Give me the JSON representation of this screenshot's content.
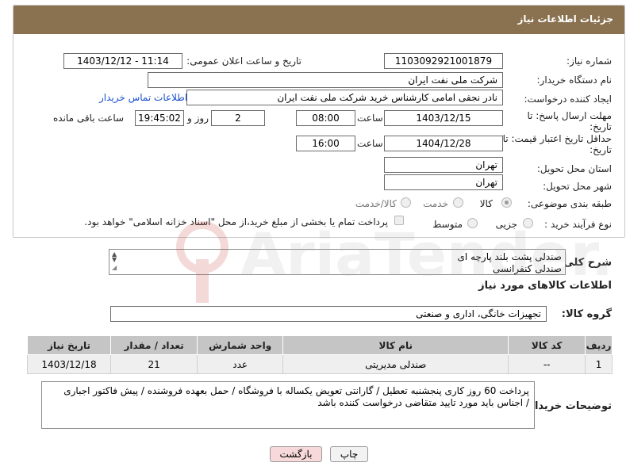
{
  "panel": {
    "title": "جزئیات اطلاعات نیاز"
  },
  "fields": {
    "need_number_label": "شماره نیاز:",
    "need_number": "1103092921001879",
    "announce_label": "تاریخ و ساعت اعلان عمومی:",
    "announce_value": "1403/12/12 - 11:14",
    "buyer_org_label": "نام دستگاه خریدار:",
    "buyer_org": "شرکت ملی نفت ایران",
    "creator_label": "ایجاد کننده درخواست:",
    "creator": "نادر نجفی امامی کارشناس خرید شرکت ملی نفت ایران",
    "contact_link": "اطلاعات تماس خریدار",
    "deadline_label": "مهلت ارسال پاسخ: تا",
    "deadline_label2": "تاریخ:",
    "deadline_date": "1403/12/15",
    "time_label": "ساعت",
    "deadline_time": "08:00",
    "days_value": "2",
    "days_label": "روز و",
    "remaining_time": "19:45:02",
    "remaining_label": "ساعت باقی مانده",
    "validity_label": "حداقل تاریخ اعتبار قیمت: تا",
    "validity_label2": "تاریخ:",
    "validity_date": "1404/12/28",
    "validity_time": "16:00",
    "province_label": "استان محل تحویل:",
    "province": "تهران",
    "city_label": "شهر محل تحویل:",
    "city": "تهران",
    "category_label": "طبقه بندی موضوعی:",
    "category_options": [
      "کالا",
      "خدمت",
      "کالا/خدمت"
    ],
    "process_label": "نوع فرآیند خرید :",
    "process_options": [
      "جزیی",
      "متوسط"
    ],
    "payment_note": "پرداخت تمام یا بخشی از مبلغ خرید،از محل \"اسناد خزانه اسلامی\" خواهد بود."
  },
  "description": {
    "label": "شرح کلی نیاز:",
    "lines": [
      "صندلی پشت بلند پارچه ای",
      "صندلی کنفرانسی"
    ]
  },
  "goods": {
    "section_title": "اطلاعات کالاهای مورد نیاز",
    "group_label": "گروه کالا:",
    "group_value": "تجهیزات خانگی، اداری و صنعتی"
  },
  "table": {
    "headers": [
      "ردیف",
      "کد کالا",
      "نام کالا",
      "واحد شمارش",
      "تعداد / مقدار",
      "تاریخ نیاز"
    ],
    "rows": [
      [
        "1",
        "--",
        "صندلی مدیریتی",
        "عدد",
        "21",
        "1403/12/18"
      ]
    ]
  },
  "buyer_notes": {
    "label": "توضیحات خریدار:",
    "text": "پرداخت 60 روز کاری پنجشنبه تعطیل / گارانتی تعویض یکساله با فروشگاه / حمل بعهده فروشنده / پیش فاکتور اجباری / اجناس باید مورد تایید متقاضی درخواست کننده باشد"
  },
  "buttons": {
    "print": "چاپ",
    "back": "بازگشت"
  },
  "watermark_text": "AriaTender.neT",
  "colors": {
    "header": "#8a7150",
    "link": "#1a4fd1",
    "back_button": "#f7d9d9"
  },
  "icons": [
    "spinner-arrows-icon",
    "resize-grip-icon",
    "aria-tender-logo"
  ]
}
